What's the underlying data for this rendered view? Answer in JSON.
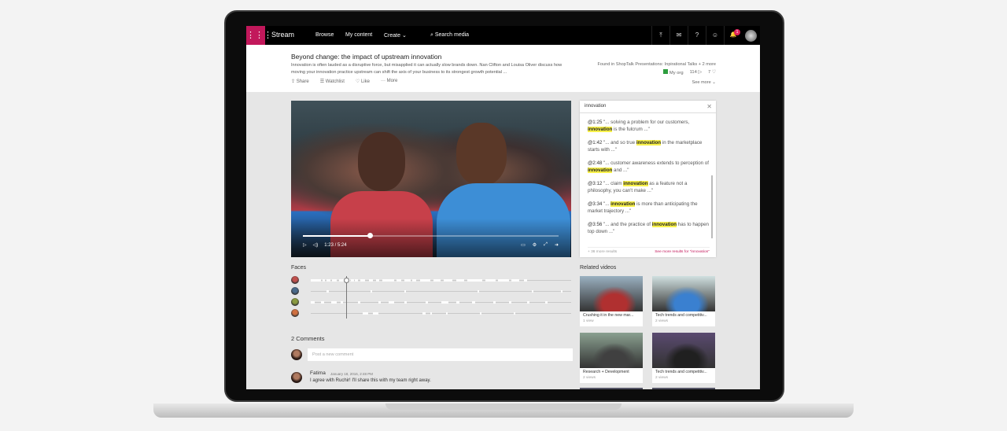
{
  "topbar": {
    "brand": "Stream",
    "nav": [
      "Browse",
      "My content",
      "Create ⌄"
    ],
    "search_placeholder": "Search media",
    "icons": [
      "upload-icon",
      "mail-icon",
      "help-icon",
      "smiley-icon",
      "bell-icon"
    ],
    "icon_glyphs": [
      "⤒",
      "✉",
      "?",
      "☺",
      "🔔"
    ],
    "notification_count": "1"
  },
  "video": {
    "title": "Beyond change: the impact of upstream innovation",
    "description": "Innovation is often lauded as a disruptive force, but misapplied it can actually slow brands down. Nan Clifton and Louisa Oliver discuss how moving your innovation practice upstream can shift the axis of your business to its strongest growth potential ...",
    "actions": [
      "Share",
      "Watchlist",
      "Like",
      "More"
    ],
    "found_in": "Found in ShopTalk Presentations: Inpirational Talks + 2 more",
    "visibility": "My org",
    "views": "114",
    "likes": "7",
    "see_more": "See more ⌄",
    "time": "1:23 / 5:24",
    "progress": 0.26
  },
  "transcript": {
    "query": "innovation",
    "items": [
      {
        "time": "@1:25",
        "pre": " \"... solving a problem for our customers, ",
        "hit": "innovation",
        "post": " is the fulcrum ...\""
      },
      {
        "time": "@1:42",
        "pre": " \"... and so true ",
        "hit": "innovation",
        "post": " in the marketplace starts with ...\""
      },
      {
        "time": "@2:48",
        "pre": " \"... customer awareness extends to perception of ",
        "hit": "innovation",
        "post": " and ...\""
      },
      {
        "time": "@3:12",
        "pre": " \"... claim ",
        "hit": "innovation",
        "post": " as a feature not a philosophy, you can't make ...\""
      },
      {
        "time": "@3:34",
        "pre": " \"... ",
        "hit": "innovation",
        "post": " is more than anticipating the market trajectory ...\""
      },
      {
        "time": "@3:56",
        "pre": " \"... and the practice of ",
        "hit": "innovation",
        "post": " has to happen top down ...\""
      }
    ],
    "more_count": "+ 36 more results",
    "see_more": "See more results for \"innovation\""
  },
  "faces": {
    "heading": "Faces",
    "colors": [
      "#c0504d",
      "#4a6a8a",
      "#8a9a40",
      "#d07040"
    ]
  },
  "comments": {
    "heading": "2 Comments",
    "placeholder": "Post a new comment",
    "items": [
      {
        "author": "Fatima",
        "date": "January 18, 2016, 2:48 PM",
        "text": "I agree with Ruchir! I'll share this with my team right away."
      }
    ]
  },
  "related": {
    "heading": "Related videos",
    "items": [
      {
        "title": "Crushing it in the new mar...",
        "views": "1 view",
        "colors": [
          "#9ab0c0",
          "#b03030"
        ]
      },
      {
        "title": "Tech trends and competitiv...",
        "views": "2 views",
        "colors": [
          "#d0e0e0",
          "#3a80d0"
        ]
      },
      {
        "title": "Research + Development",
        "views": "2 views",
        "colors": [
          "#8aa090",
          "#404040"
        ]
      },
      {
        "title": "Tech trends and competitiv...",
        "views": "2 views",
        "colors": [
          "#5a4a70",
          "#202020"
        ]
      }
    ]
  }
}
